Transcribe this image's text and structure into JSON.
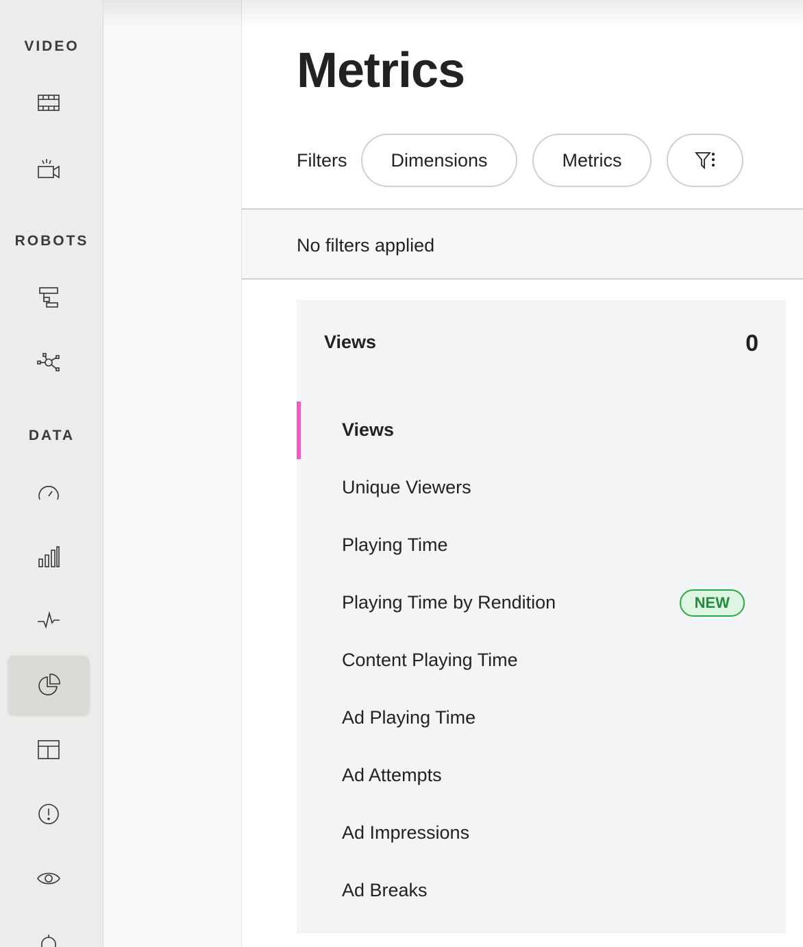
{
  "sidebar": {
    "sections": [
      {
        "label": "VIDEO"
      },
      {
        "label": "ROBOTS"
      },
      {
        "label": "DATA"
      }
    ],
    "icons": [
      "film-icon",
      "live-camera-icon",
      "workflow-icon",
      "network-icon",
      "speedometer-icon",
      "bar-chart-icon",
      "activity-icon",
      "pie-chart-icon",
      "layout-icon",
      "alert-icon",
      "eye-icon",
      "bell-icon"
    ],
    "active_icon": "pie-chart-icon"
  },
  "page": {
    "title": "Metrics"
  },
  "filters": {
    "label": "Filters",
    "dimensions_button": "Dimensions",
    "metrics_button": "Metrics",
    "status": "No filters applied"
  },
  "card": {
    "title": "Views",
    "count": "0",
    "items": [
      {
        "label": "Views",
        "active": true
      },
      {
        "label": "Unique Viewers"
      },
      {
        "label": "Playing Time"
      },
      {
        "label": "Playing Time by Rendition",
        "badge": "NEW"
      },
      {
        "label": "Content Playing Time"
      },
      {
        "label": "Ad Playing Time"
      },
      {
        "label": "Ad Attempts"
      },
      {
        "label": "Ad Impressions"
      },
      {
        "label": "Ad Breaks"
      }
    ]
  },
  "colors": {
    "accent": "#f05bc4",
    "badge_green": "#2aa84a"
  }
}
